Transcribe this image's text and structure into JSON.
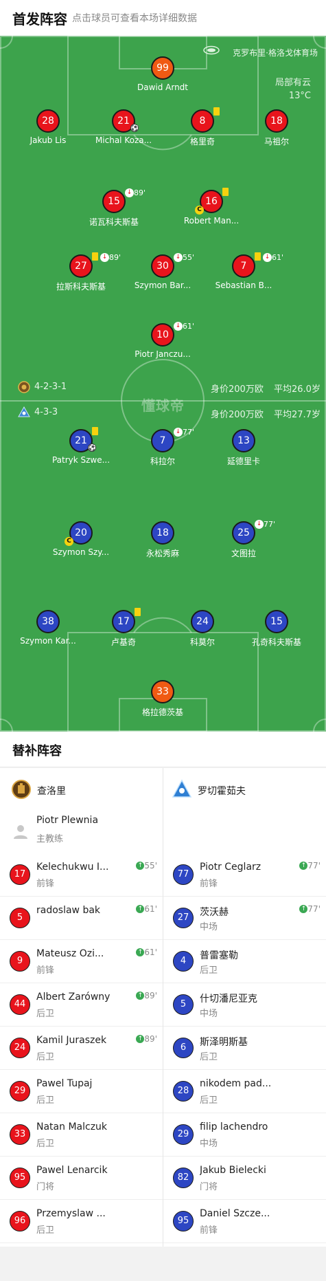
{
  "header": {
    "title": "首发阵容",
    "subtitle": "点击球员可查看本场详细数据"
  },
  "pitch": {
    "stadium": "克罗布里·格洛戈体育场",
    "weather": "局部有云",
    "temperature": "13°C",
    "watermark": "懂球帝"
  },
  "home_team": {
    "formation": "4-2-3-1",
    "value": "身价200万欧",
    "avg_age": "平均26.0岁",
    "color": "#e8141c"
  },
  "away_team": {
    "formation": "4-3-3",
    "value": "身价200万欧",
    "avg_age": "平均27.7岁",
    "color": "#2d46c3"
  },
  "home_players": [
    {
      "number": "99",
      "name": "Dawid Arndt",
      "kit": "gk"
    },
    {
      "number": "28",
      "name": "Jakub Lis",
      "kit": "red"
    },
    {
      "number": "21",
      "name": "Michal Koza...",
      "kit": "red",
      "goal": true
    },
    {
      "number": "8",
      "name": "格里奇",
      "kit": "red",
      "yellow": true
    },
    {
      "number": "18",
      "name": "马祖尔",
      "kit": "red"
    },
    {
      "number": "15",
      "name": "诺瓦科夫斯基",
      "kit": "red",
      "sub_minute": "89'"
    },
    {
      "number": "16",
      "name": "Robert Man...",
      "kit": "red",
      "yellow": true,
      "captain": true
    },
    {
      "number": "27",
      "name": "拉斯科夫斯基",
      "kit": "red",
      "yellow": true,
      "sub_minute": "89'"
    },
    {
      "number": "30",
      "name": "Szymon Bar...",
      "kit": "red",
      "sub_minute": "55'"
    },
    {
      "number": "7",
      "name": "Sebastian B...",
      "kit": "red",
      "yellow": true,
      "sub_minute": "61'"
    },
    {
      "number": "10",
      "name": "Piotr Janczu...",
      "kit": "red",
      "sub_minute": "61'"
    }
  ],
  "away_players": [
    {
      "number": "21",
      "name": "Patryk Szwe...",
      "kit": "blue",
      "yellow": true,
      "goal": true
    },
    {
      "number": "7",
      "name": "科拉尔",
      "kit": "blue",
      "sub_minute": "77'"
    },
    {
      "number": "13",
      "name": "延德里卡",
      "kit": "blue"
    },
    {
      "number": "20",
      "name": "Szymon Szy...",
      "kit": "blue",
      "captain": true
    },
    {
      "number": "18",
      "name": "永松秀麻",
      "kit": "blue"
    },
    {
      "number": "25",
      "name": "文图拉",
      "kit": "blue",
      "sub_minute": "77'"
    },
    {
      "number": "38",
      "name": "Szymon Kar...",
      "kit": "blue"
    },
    {
      "number": "17",
      "name": "卢基奇",
      "kit": "blue",
      "yellow": true
    },
    {
      "number": "24",
      "name": "科莫尔",
      "kit": "blue"
    },
    {
      "number": "15",
      "name": "孔奇科夫斯基",
      "kit": "blue"
    },
    {
      "number": "33",
      "name": "格拉德茨基",
      "kit": "gk"
    }
  ],
  "bench": {
    "title": "替补阵容",
    "home_name": "查洛里",
    "away_name": "罗切霍茹夫",
    "coach": {
      "name": "Piotr Plewnia",
      "role": "主教练"
    },
    "home": [
      {
        "number": "17",
        "name": "Kelechukwu I...",
        "position": "前锋",
        "in_minute": "55'"
      },
      {
        "number": "5",
        "name": "radoslaw bak",
        "position": "",
        "in_minute": "61'"
      },
      {
        "number": "9",
        "name": "Mateusz Ozi...",
        "position": "前锋",
        "in_minute": "61'"
      },
      {
        "number": "44",
        "name": "Albert Zarówny",
        "position": "后卫",
        "in_minute": "89'"
      },
      {
        "number": "24",
        "name": "Kamil Juraszek",
        "position": "后卫",
        "in_minute": "89'"
      },
      {
        "number": "29",
        "name": "Pawel Tupaj",
        "position": "后卫",
        "in_minute": ""
      },
      {
        "number": "33",
        "name": "Natan Malczuk",
        "position": "后卫",
        "in_minute": ""
      },
      {
        "number": "95",
        "name": "Pawel Lenarcik",
        "position": "门将",
        "in_minute": ""
      },
      {
        "number": "96",
        "name": "Przemyslaw ...",
        "position": "后卫",
        "in_minute": ""
      }
    ],
    "away": [
      {
        "number": "77",
        "name": "Piotr Ceglarz",
        "position": "前锋",
        "in_minute": "77'"
      },
      {
        "number": "27",
        "name": "茨沃赫",
        "position": "中场",
        "in_minute": "77'"
      },
      {
        "number": "4",
        "name": "普雷塞勒",
        "position": "后卫",
        "in_minute": ""
      },
      {
        "number": "5",
        "name": "什切潘尼亚克",
        "position": "中场",
        "in_minute": ""
      },
      {
        "number": "6",
        "name": "斯泽明斯基",
        "position": "后卫",
        "in_minute": ""
      },
      {
        "number": "28",
        "name": "nikodem pad...",
        "position": "后卫",
        "in_minute": ""
      },
      {
        "number": "29",
        "name": "filip lachendro",
        "position": "中场",
        "in_minute": ""
      },
      {
        "number": "82",
        "name": "Jakub Bielecki",
        "position": "门将",
        "in_minute": ""
      },
      {
        "number": "95",
        "name": "Daniel Szcze...",
        "position": "前锋",
        "in_minute": ""
      }
    ]
  }
}
